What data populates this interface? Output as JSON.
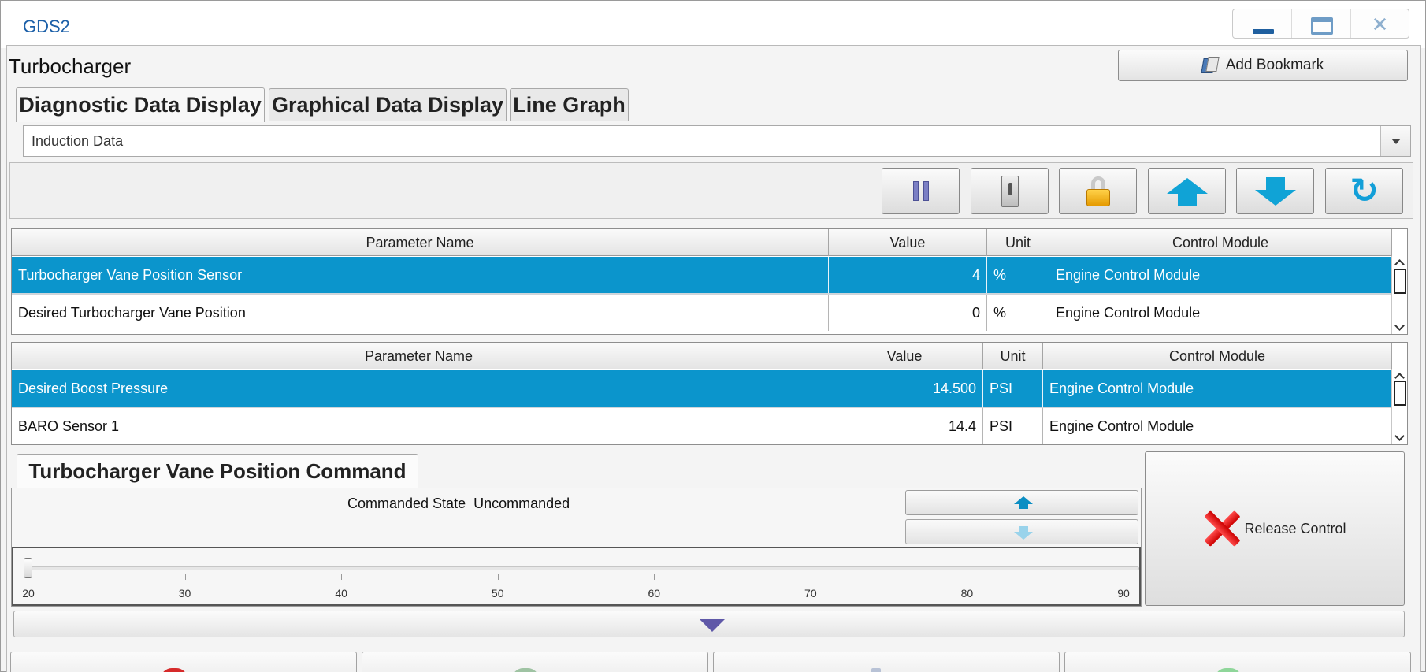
{
  "window": {
    "title": "GDS2"
  },
  "page": {
    "title": "Turbocharger",
    "bookmark_label": "Add Bookmark"
  },
  "tabs": [
    {
      "label": "Diagnostic Data Display",
      "active": true
    },
    {
      "label": "Graphical Data Display",
      "active": false
    },
    {
      "label": "Line Graph",
      "active": false
    }
  ],
  "dropdown": {
    "selected": "Induction Data"
  },
  "toolbar": {
    "icons": [
      "pause-icon",
      "toggle-switch-icon",
      "lock-icon",
      "arrow-up-icon",
      "arrow-down-icon",
      "refresh-icon"
    ]
  },
  "table_headers": [
    "Parameter Name",
    "Value",
    "Unit",
    "Control Module"
  ],
  "table1": {
    "rows": [
      {
        "name": "Turbocharger Vane Position Sensor",
        "value": "4",
        "unit": "%",
        "module": "Engine Control Module",
        "selected": true
      },
      {
        "name": "Desired Turbocharger Vane Position",
        "value": "0",
        "unit": "%",
        "module": "Engine Control Module",
        "selected": false
      }
    ]
  },
  "table2": {
    "rows": [
      {
        "name": "Desired Boost Pressure",
        "value": "14.500",
        "unit": "PSI",
        "module": "Engine Control Module",
        "selected": true
      },
      {
        "name": "BARO Sensor 1",
        "value": "14.4",
        "unit": "PSI",
        "module": "Engine Control Module",
        "selected": false
      }
    ]
  },
  "command": {
    "tab_label": "Turbocharger Vane Position Command",
    "state_label": "Commanded State",
    "state_value": "Uncommanded",
    "slider": {
      "min": 20,
      "max": 90,
      "value": 20,
      "ticks": [
        "20",
        "30",
        "40",
        "50",
        "60",
        "70",
        "80",
        "90"
      ]
    },
    "release_label": "Release Control"
  },
  "colors": {
    "selected_row": "#0b95cc",
    "title_blue": "#1b5fa8",
    "arrow_blue": "#10a3d6",
    "release_red": "#e00000"
  }
}
